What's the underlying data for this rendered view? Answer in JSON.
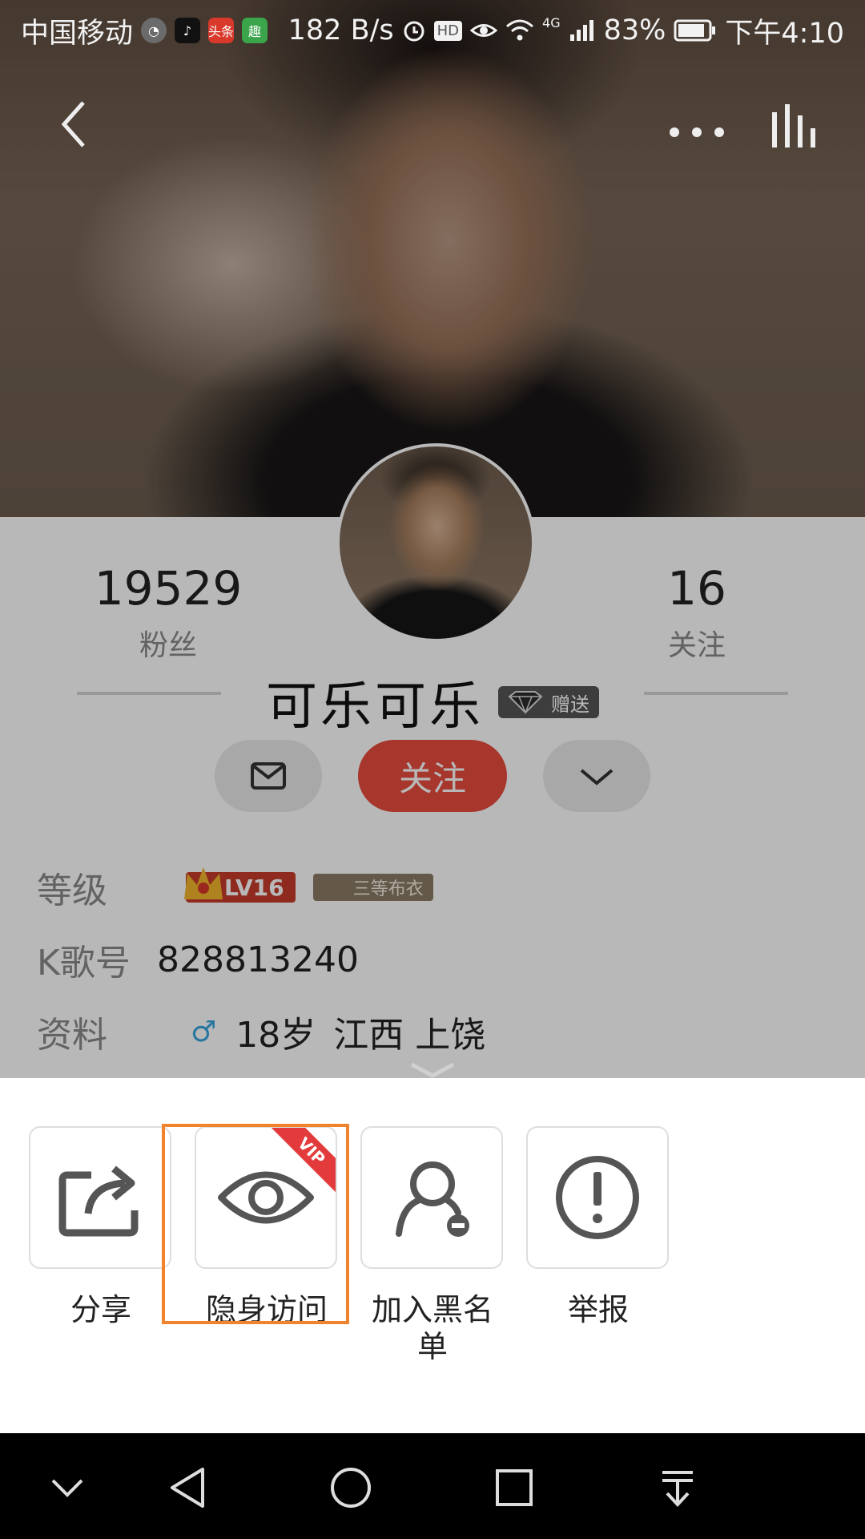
{
  "status_bar": {
    "carrier": "中国移动",
    "apps": [
      "头条",
      "趣"
    ],
    "net_speed": "182 B/s",
    "hd": "HD",
    "network": "4G",
    "battery": "83%",
    "time": "下午4:10"
  },
  "profile": {
    "fans_count": "19529",
    "fans_label": "粉丝",
    "following_count": "16",
    "following_label": "关注",
    "username": "可乐可乐",
    "gift_badge": "赠送",
    "follow_button": "关注",
    "level_label": "等级",
    "level_badge": "LV16",
    "rank_badge": "三等布衣",
    "kge_label": "K歌号",
    "kge_id": "828813240",
    "info_label": "资料",
    "gender_symbol": "♂",
    "age": "18岁",
    "province": "江西",
    "city": "上饶"
  },
  "sheet": {
    "items": [
      {
        "label": "分享",
        "icon": "share-icon"
      },
      {
        "label": "隐身访问",
        "icon": "eye-icon",
        "badge": "VIP"
      },
      {
        "label": "加入黑名单",
        "icon": "block-user-icon"
      },
      {
        "label": "举报",
        "icon": "report-icon"
      }
    ]
  },
  "colors": {
    "accent": "#e84c3d",
    "highlight": "#f0832b",
    "vip": "#e33b3b"
  }
}
